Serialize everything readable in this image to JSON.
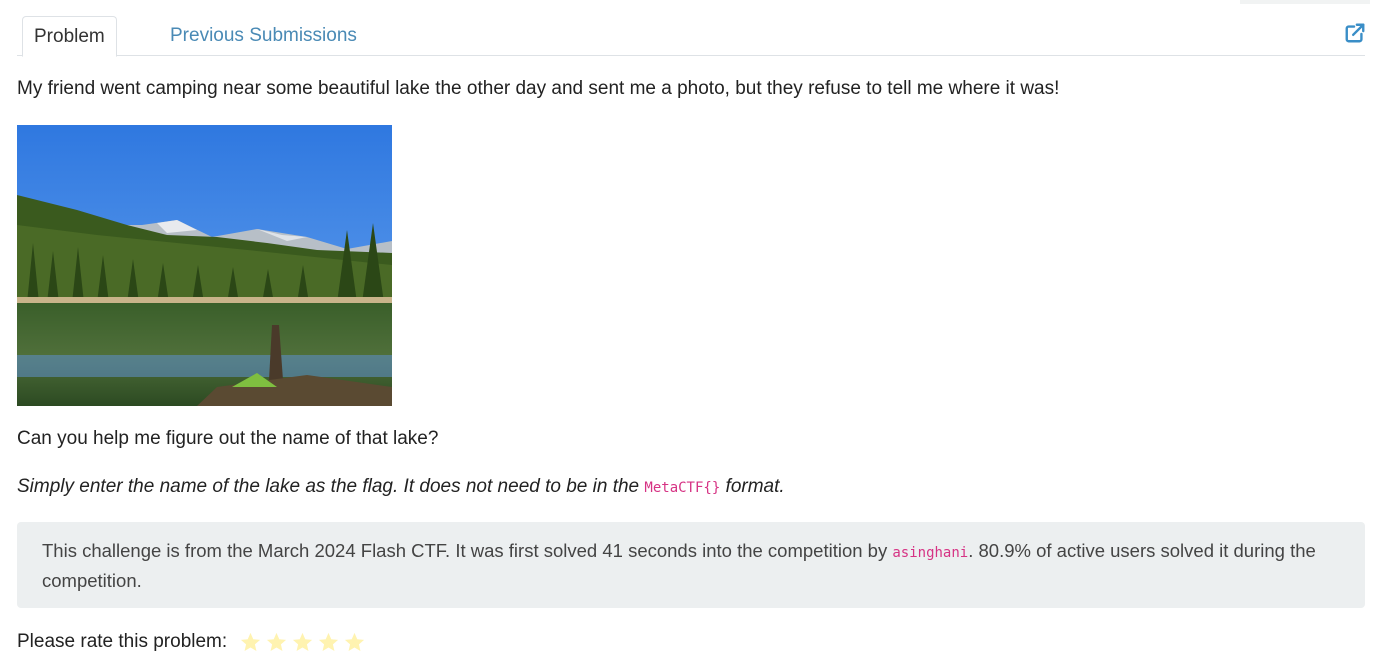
{
  "tabs": {
    "problem": "Problem",
    "previous_submissions": "Previous Submissions"
  },
  "icons": {
    "external_link": "external-link-icon",
    "star": "star-icon"
  },
  "colors": {
    "tab_link": "#4a8ab5",
    "code_text": "#d63384",
    "info_box_bg": "#eceff0",
    "star": "#fff3b0"
  },
  "problem": {
    "intro": "My friend went camping near some beautiful lake the other day and sent me a photo, but they refuse to tell me where it was!",
    "question": "Can you help me figure out the name of that lake?",
    "note_before": "Simply enter the name of the lake as the flag. It does not need to be in the ",
    "note_code": "MetaCTF{}",
    "note_after": " format."
  },
  "info": {
    "text_before": "This challenge is from the March 2024 Flash CTF. It was first solved 41 seconds into the competition by ",
    "user": "asinghani",
    "text_after": ". 80.9% of active users solved it during the competition."
  },
  "rating": {
    "label": "Please rate this problem:",
    "max_stars": 5
  }
}
